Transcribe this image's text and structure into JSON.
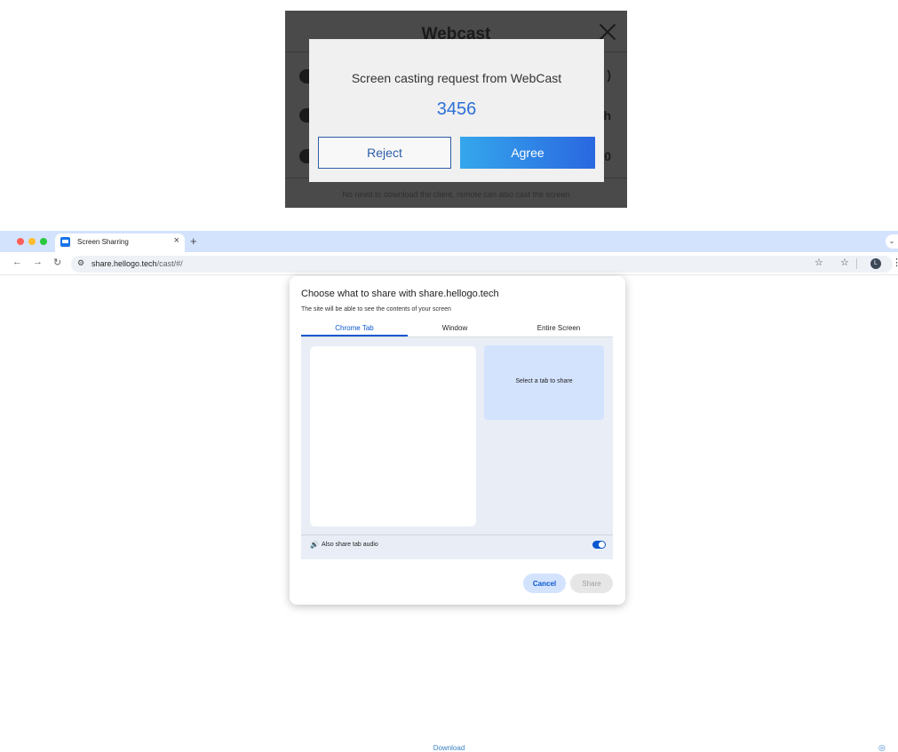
{
  "phone": {
    "title": "Webcast",
    "row_right_1": ")",
    "row_right_2": "h",
    "row_right_3": "0",
    "footer": "No need to download the client, remote can also cast the screen",
    "modal": {
      "message": "Screen casting request from WebCast",
      "code": "3456",
      "reject_label": "Reject",
      "agree_label": "Agree"
    }
  },
  "browser": {
    "tab_title": "Screen Sharring",
    "tab_close": "×",
    "new_tab": "+",
    "tab_more": "⌄",
    "url_host": "share.hellogo.tech",
    "url_path": "/cast/#/",
    "avatar_letter": "L"
  },
  "share_dialog": {
    "title": "Choose what to share with share.hellogo.tech",
    "subtitle": "The site will be able to see the contents of your screen",
    "tabs": [
      "Chrome Tab",
      "Window",
      "Entire Screen"
    ],
    "active_tab": "Chrome Tab",
    "preview_text": "Select a tab to share",
    "audio_label": "Also share tab audio",
    "audio_enabled": true,
    "cancel_label": "Cancel",
    "share_label": "Share"
  },
  "page": {
    "download_label": "Download"
  },
  "colors": {
    "accent": "#0b57d0",
    "tabstrip": "#d3e3fd",
    "agree_gradient_start": "#35a7ec",
    "agree_gradient_end": "#2a67e0"
  }
}
